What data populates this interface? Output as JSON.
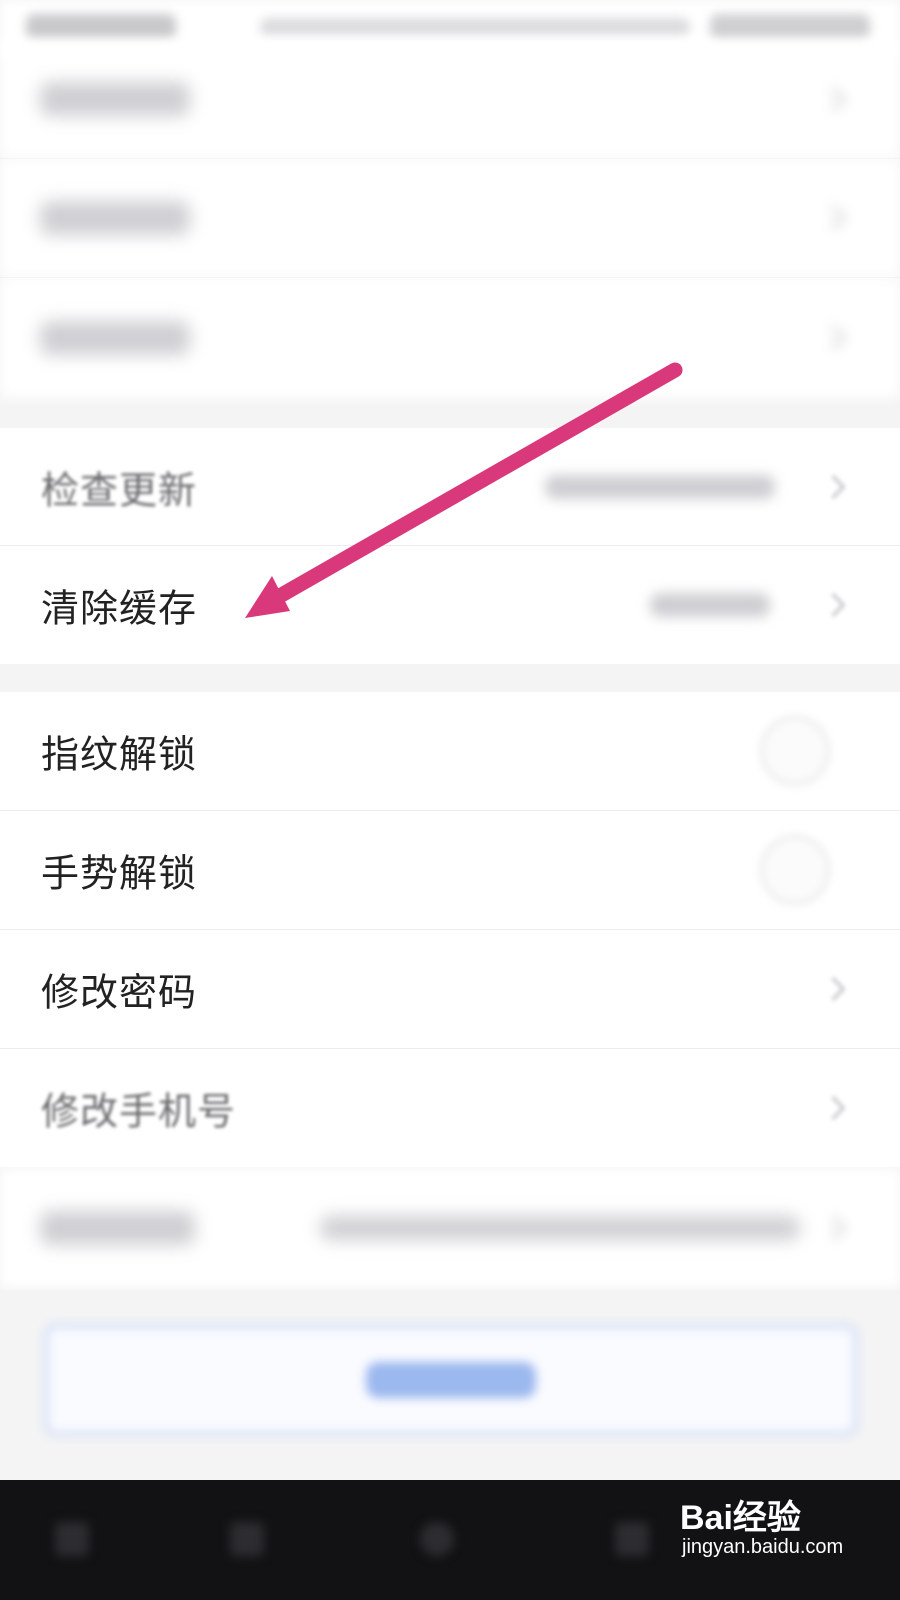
{
  "settings": {
    "check_update": {
      "label": "检查更新"
    },
    "clear_cache": {
      "label": "清除缓存"
    },
    "fingerprint_unlock": {
      "label": "指纹解锁"
    },
    "gesture_unlock": {
      "label": "手势解锁"
    },
    "change_password": {
      "label": "修改密码"
    },
    "change_phone": {
      "label": "修改手机号"
    }
  },
  "annotation": {
    "arrow_color": "#d9387a"
  },
  "watermark": {
    "brand": "Bai经验",
    "url": "jingyan.baidu.com"
  },
  "colors": {
    "logout_border": "#b9cdf3",
    "nav_bar": "#121214"
  }
}
